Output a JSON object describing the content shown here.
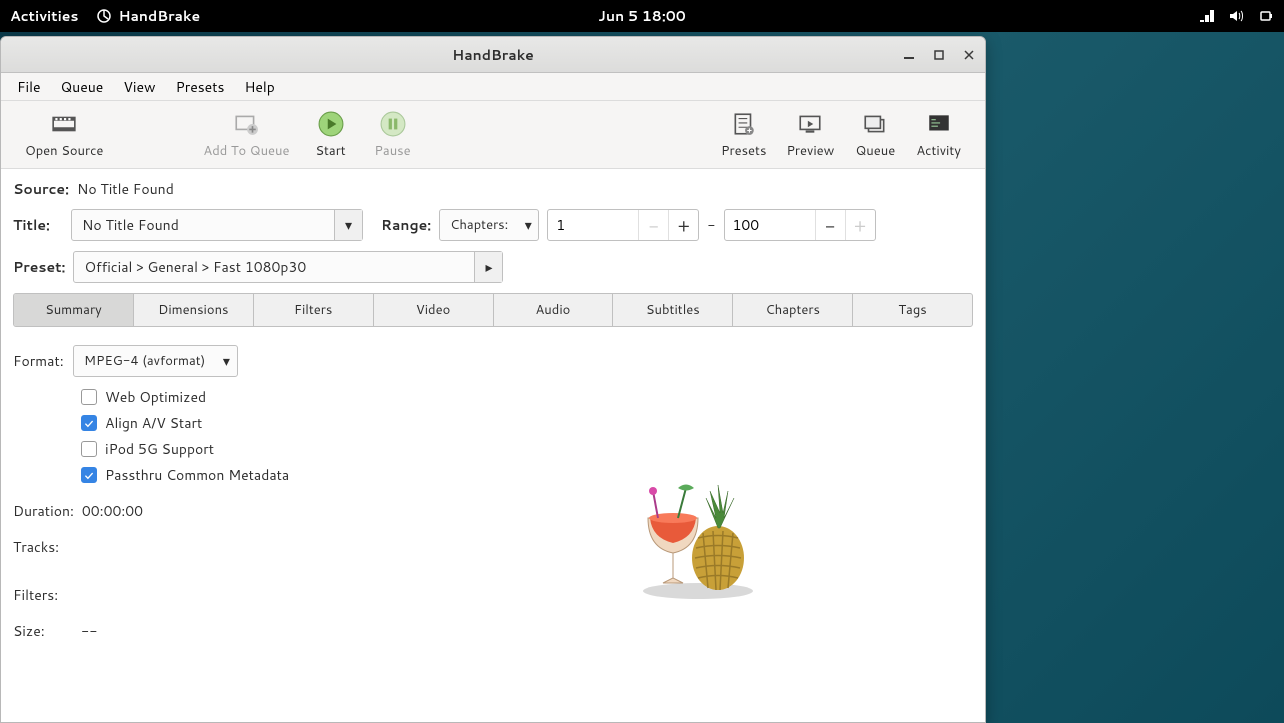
{
  "topbar": {
    "activities": "Activities",
    "app_name": "HandBrake",
    "datetime": "Jun 5  18:00"
  },
  "window": {
    "title": "HandBrake"
  },
  "menubar": [
    "File",
    "Queue",
    "View",
    "Presets",
    "Help"
  ],
  "toolbar": {
    "open_source": "Open Source",
    "add_queue": "Add To Queue",
    "start": "Start",
    "pause": "Pause",
    "presets": "Presets",
    "preview": "Preview",
    "queue": "Queue",
    "activity": "Activity"
  },
  "source": {
    "label": "Source:",
    "value": "No Title Found"
  },
  "title": {
    "label": "Title:",
    "value": "No Title Found"
  },
  "range": {
    "label": "Range:",
    "type": "Chapters:",
    "from": "1",
    "to": "100",
    "sep": "-"
  },
  "preset": {
    "label": "Preset:",
    "value": "Official > General > Fast 1080p30"
  },
  "tabs": [
    "Summary",
    "Dimensions",
    "Filters",
    "Video",
    "Audio",
    "Subtitles",
    "Chapters",
    "Tags"
  ],
  "summary": {
    "format_label": "Format:",
    "format_value": "MPEG-4 (avformat)",
    "checks": {
      "web": "Web Optimized",
      "align": "Align A/V Start",
      "ipod": "iPod 5G Support",
      "passthru": "Passthru Common Metadata"
    },
    "duration_label": "Duration:",
    "duration_value": "00:00:00",
    "tracks_label": "Tracks:",
    "filters_label": "Filters:",
    "size_label": "Size:",
    "size_value": "--"
  }
}
